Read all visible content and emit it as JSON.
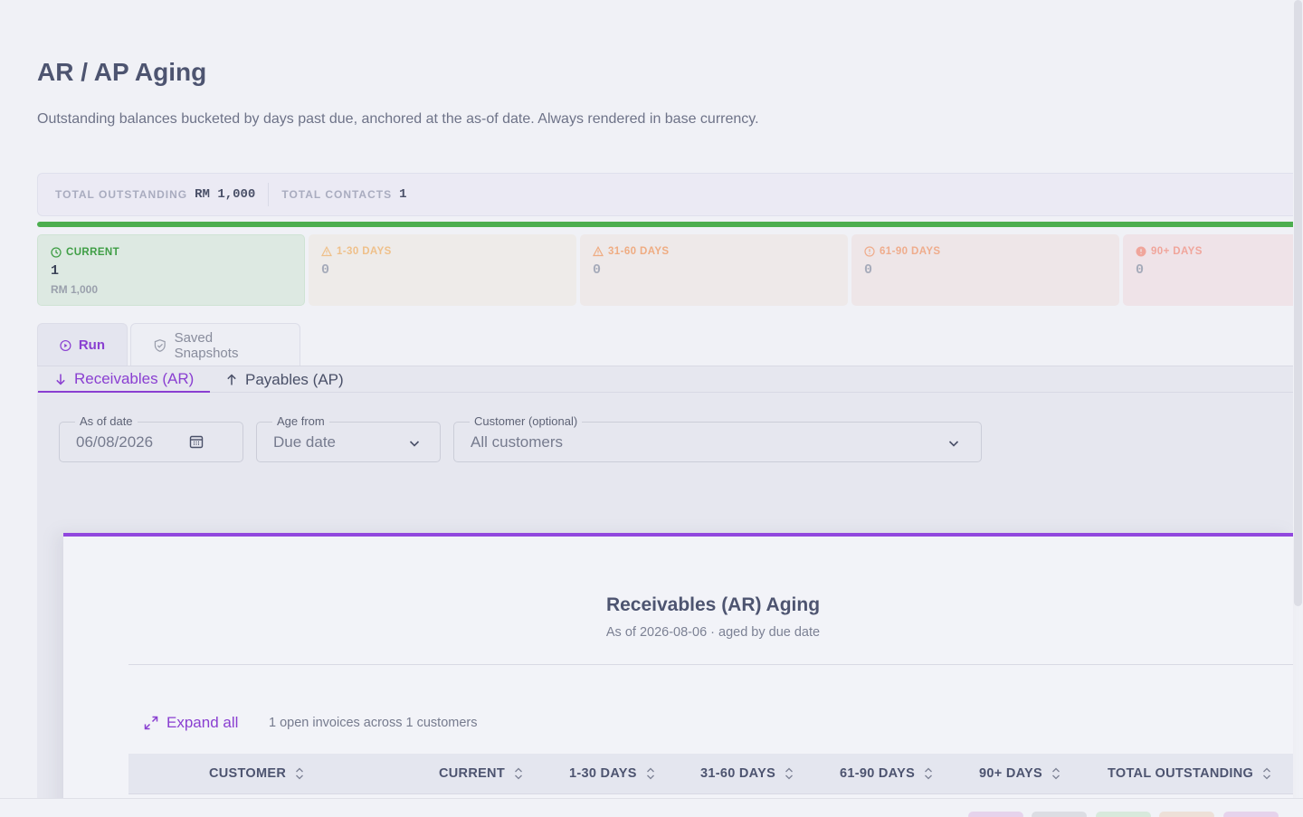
{
  "page": {
    "title": "AR / AP Aging",
    "subtitle": "Outstanding balances bucketed by days past due, anchored at the as-of date. Always rendered in base currency."
  },
  "totals": {
    "outstanding_label": "TOTAL OUTSTANDING",
    "outstanding_value": "RM 1,000",
    "contacts_label": "TOTAL CONTACTS",
    "contacts_value": "1"
  },
  "progress": {
    "current_fraction": 1.0,
    "color": "#4cae4f"
  },
  "buckets": [
    {
      "label": "CURRENT",
      "count": "1",
      "amount": "RM 1,000",
      "icon": "clock-icon",
      "color": "#4cae4f"
    },
    {
      "label": "1-30 DAYS",
      "count": "0",
      "icon": "warning-icon",
      "color": "#efc08a"
    },
    {
      "label": "31-60 DAYS",
      "count": "0",
      "icon": "warning-icon",
      "color": "#efac82"
    },
    {
      "label": "61-90 DAYS",
      "count": "0",
      "icon": "alert-circle-icon",
      "color": "#efac8c"
    },
    {
      "label": "90+ DAYS",
      "count": "0",
      "icon": "error-circle-icon",
      "color": "#f0a59b"
    }
  ],
  "tabs": {
    "run": "Run",
    "snapshots": "Saved Snapshots"
  },
  "subtabs": {
    "ar": "Receivables (AR)",
    "ap": "Payables (AP)"
  },
  "filters": {
    "as_of_label": "As of date",
    "as_of_value": "06/08/2026",
    "age_from_label": "Age from",
    "age_from_value": "Due date",
    "customer_label": "Customer (optional)",
    "customer_value": "All customers"
  },
  "report": {
    "title": "Receivables (AR) Aging",
    "subtitle": "As of 2026-08-06 · aged by due date",
    "expand_label": "Expand all",
    "count_text": "1 open invoices across 1 customers",
    "columns": [
      "CUSTOMER",
      "CURRENT",
      "1-30 DAYS",
      "31-60 DAYS",
      "61-90 DAYS",
      "90+ DAYS",
      "TOTAL OUTSTANDING"
    ]
  },
  "colors": {
    "accent": "#8a3fd1",
    "success": "#4cae4f"
  }
}
